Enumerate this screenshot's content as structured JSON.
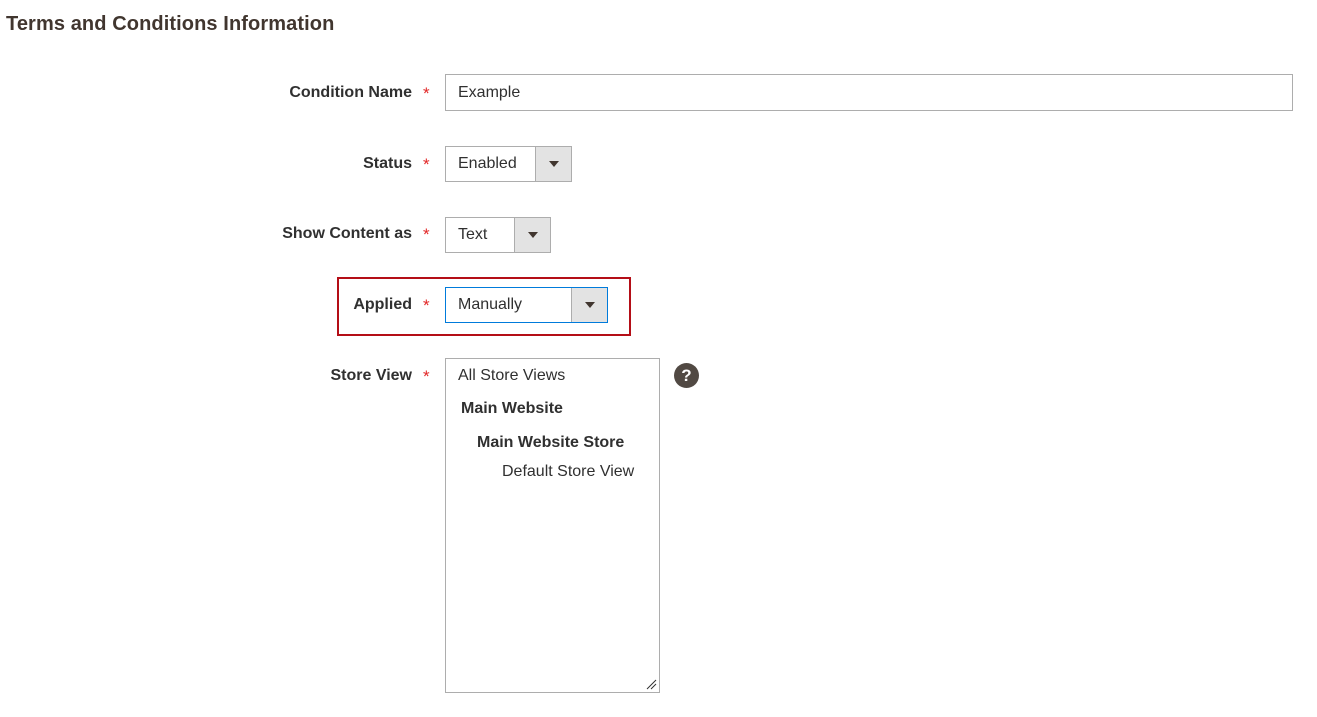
{
  "section": {
    "title": "Terms and Conditions Information"
  },
  "required_marker": "*",
  "fields": {
    "condition_name": {
      "label": "Condition Name",
      "value": "Example"
    },
    "status": {
      "label": "Status",
      "selected": "Enabled"
    },
    "show_content_as": {
      "label": "Show Content as",
      "selected": "Text"
    },
    "applied": {
      "label": "Applied",
      "selected": "Manually"
    },
    "store_view": {
      "label": "Store View",
      "options": {
        "all": "All Store Views",
        "website": "Main Website",
        "store": "Main Website Store",
        "view": "Default Store View"
      },
      "help_icon": "question-circle-icon"
    }
  },
  "colors": {
    "required": "#e22626",
    "highlight": "#b40e17",
    "focus": "#007bdb",
    "help_bg": "#514943"
  }
}
